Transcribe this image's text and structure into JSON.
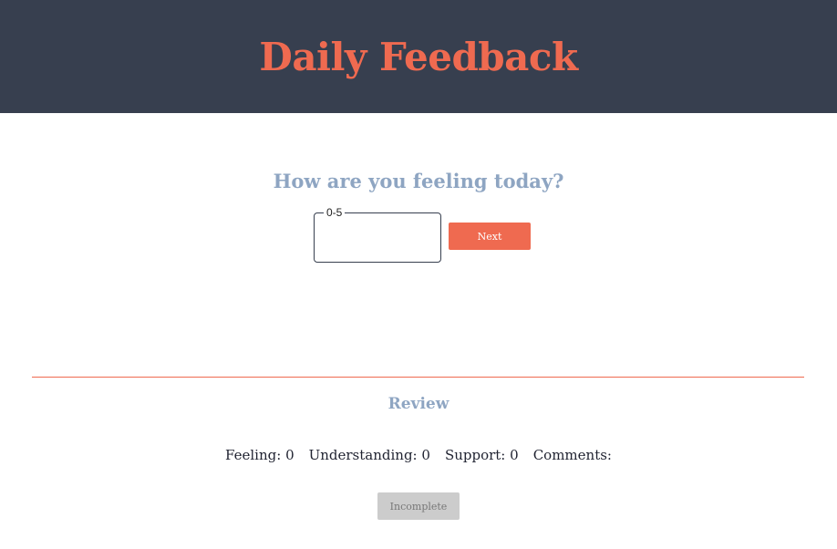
{
  "header": {
    "title": "Daily Feedback"
  },
  "question": {
    "prompt": "How are you feeling today?",
    "field_label": "0-5",
    "field_value": "",
    "next_label": "Next"
  },
  "review": {
    "title": "Review",
    "items": [
      {
        "label": "Feeling:",
        "value": "0"
      },
      {
        "label": "Understanding:",
        "value": "0"
      },
      {
        "label": "Support:",
        "value": "0"
      },
      {
        "label": "Comments:",
        "value": ""
      }
    ],
    "status_label": "Incomplete"
  },
  "colors": {
    "header_bg": "#373f4f",
    "accent": "#ef6a50",
    "heading": "#8ea5c2",
    "disabled": "#cccccc"
  }
}
